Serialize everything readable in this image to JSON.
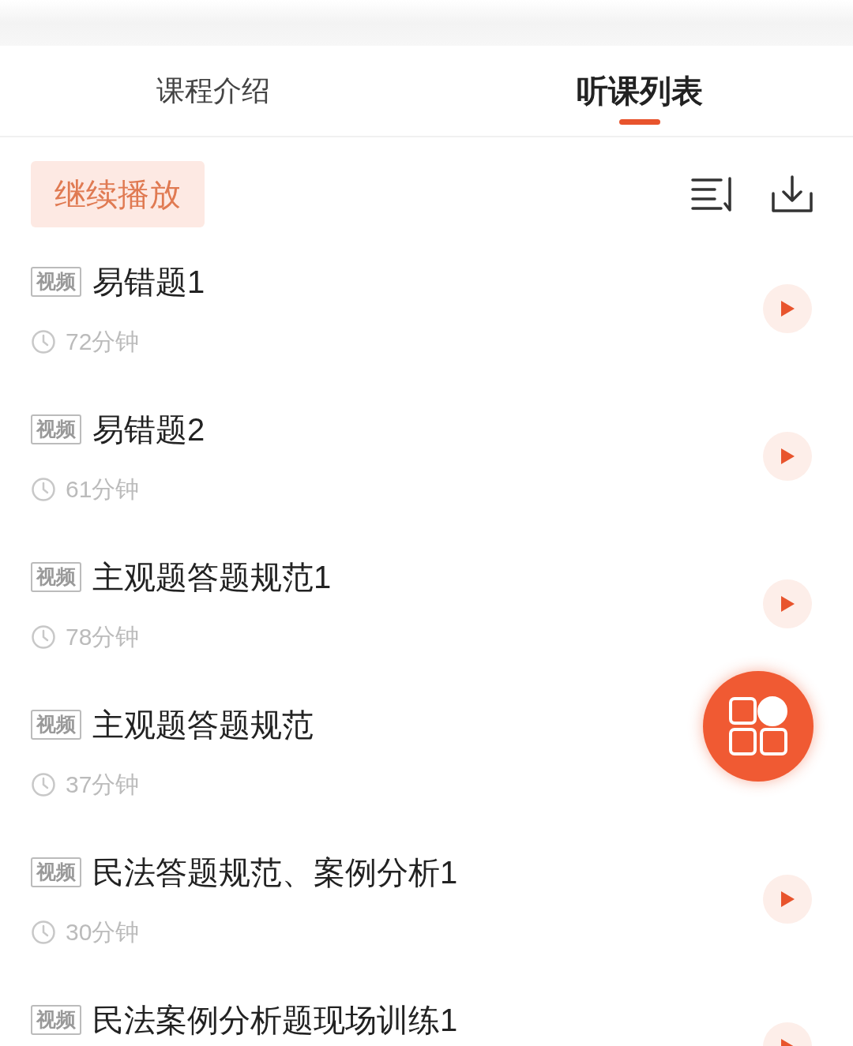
{
  "tabs": [
    {
      "label": "课程介绍",
      "selected": false
    },
    {
      "label": "听课列表",
      "selected": true
    }
  ],
  "continue_button": "继续播放",
  "lessons": [
    {
      "tag": "视频",
      "title": "易错题1",
      "duration": "72分钟"
    },
    {
      "tag": "视频",
      "title": "易错题2",
      "duration": "61分钟"
    },
    {
      "tag": "视频",
      "title": "主观题答题规范1",
      "duration": "78分钟"
    },
    {
      "tag": "视频",
      "title": "主观题答题规范",
      "duration": "37分钟",
      "play_visible": false
    },
    {
      "tag": "视频",
      "title": "民法答题规范、案例分析1",
      "duration": "30分钟"
    },
    {
      "tag": "视频",
      "title": "民法案例分析题现场训练1"
    }
  ]
}
